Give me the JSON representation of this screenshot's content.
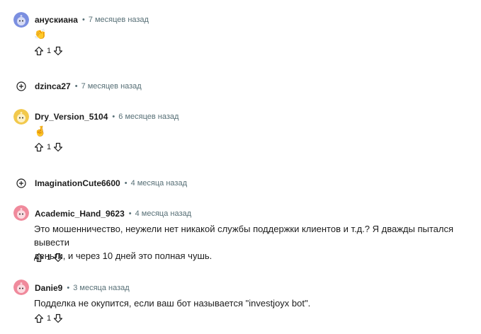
{
  "comments": [
    {
      "username": "анускиана",
      "time": "7 месяцев назад",
      "body": "👏",
      "votes": "1",
      "avatar_color": "#7b8fe0",
      "collapsed": false
    },
    {
      "username": "dzinca27",
      "time": "7 месяцев назад",
      "collapsed": true
    },
    {
      "username": "Dry_Version_5104",
      "time": "6 месяцев назад",
      "body": "🤞",
      "votes": "1",
      "avatar_color": "#f2c94c",
      "collapsed": false
    },
    {
      "username": "ImaginationCute6600",
      "time": "4 месяца назад",
      "collapsed": true
    },
    {
      "username": "Academic_Hand_9623",
      "time": "4 месяца назад",
      "body_lines": [
        "Это мошенничество, неужели нет никакой службы поддержки клиентов и т.д.? Я дважды пытался вывести",
        "деньги, и через 10 дней это полная чушь."
      ],
      "votes": "1",
      "avatar_color": "#f08a9c",
      "collapsed": false
    },
    {
      "username": "Danie9",
      "time": "3 месяца назад",
      "body": "Подделка не окупится, если ваш бот называется \"investjoyx bot\".",
      "votes": "1",
      "avatar_color": "#f08a9c",
      "collapsed": false
    }
  ],
  "separator": "•",
  "icons": {
    "upvote": "arrow-up-outline",
    "downvote": "arrow-down-outline",
    "expand": "plus-circle"
  }
}
